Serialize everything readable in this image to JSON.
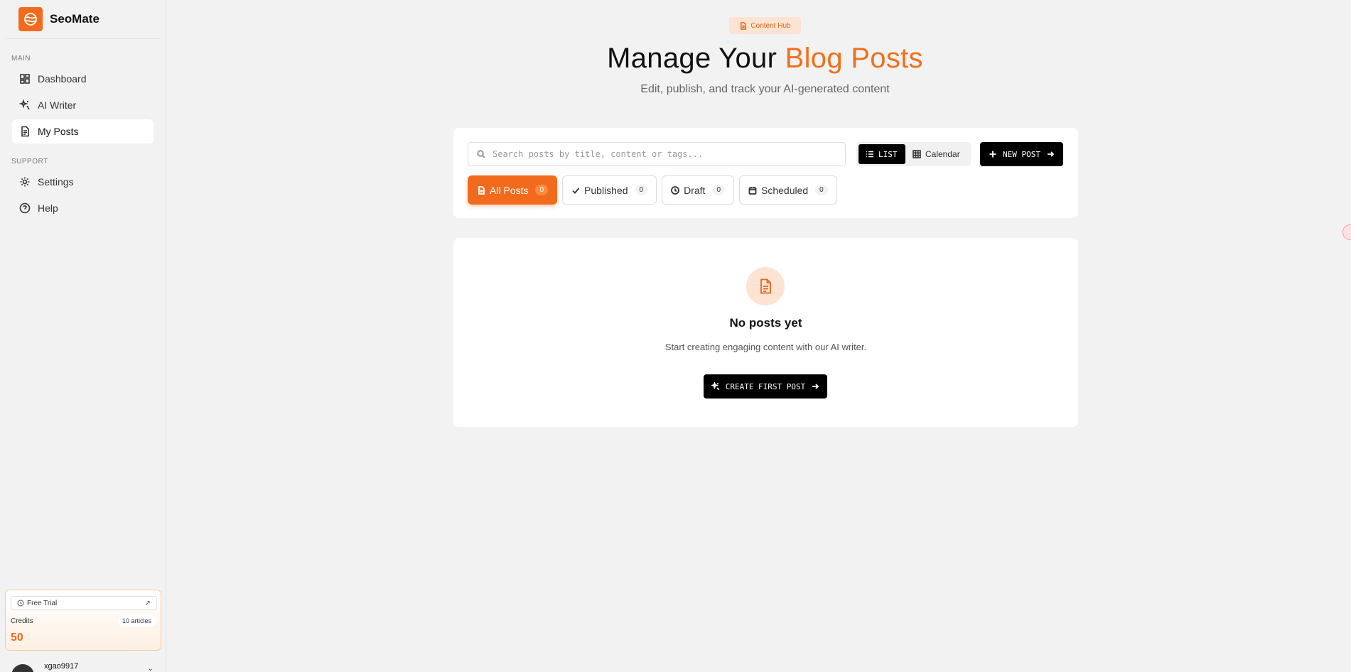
{
  "brand": {
    "name": "SeoMate"
  },
  "sidebar": {
    "main_label": "MAIN",
    "main_items": [
      {
        "label": "Dashboard",
        "icon": "dashboard-icon"
      },
      {
        "label": "AI Writer",
        "icon": "sparkles-icon"
      },
      {
        "label": "My Posts",
        "icon": "document-icon",
        "active": true
      }
    ],
    "support_label": "SUPPORT",
    "support_items": [
      {
        "label": "Settings",
        "icon": "gear-icon"
      },
      {
        "label": "Help",
        "icon": "help-icon"
      }
    ],
    "trial": {
      "plan": "Free Trial",
      "credits_label": "Credits",
      "articles": "10 articles",
      "credits_value": "50"
    },
    "user": {
      "name": "xgao9917"
    }
  },
  "header": {
    "badge": "Content Hub",
    "title_plain": "Manage Your ",
    "title_accent": "Blog Posts",
    "subtitle": "Edit, publish, and track your AI-generated content"
  },
  "toolbar": {
    "search_placeholder": "Search posts by title, content or tags...",
    "view_list": "LIST",
    "view_calendar": "Calendar",
    "new_post": "NEW POST"
  },
  "tabs": [
    {
      "label": "All Posts",
      "count": "0",
      "active": true
    },
    {
      "label": "Published",
      "count": "0"
    },
    {
      "label": "Draft",
      "count": "0"
    },
    {
      "label": "Scheduled",
      "count": "0"
    }
  ],
  "empty_state": {
    "title": "No posts yet",
    "subtitle": "Start creating engaging content with our AI writer.",
    "button": "CREATE FIRST POST"
  },
  "colors": {
    "accent": "#f26b1d",
    "accent_soft": "#fde3d2"
  }
}
